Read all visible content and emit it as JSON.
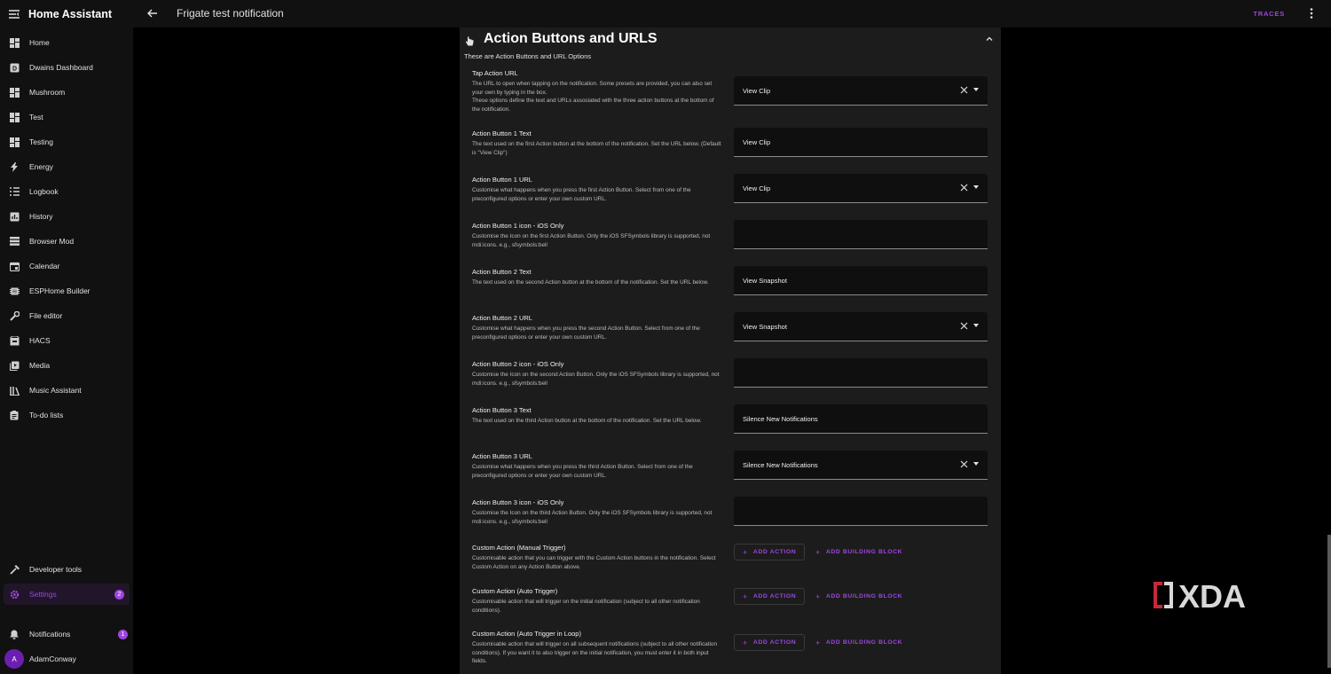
{
  "app": {
    "title": "Home Assistant"
  },
  "page": {
    "title": "Frigate test notification",
    "traces_label": "TRACES"
  },
  "sidebar": {
    "items": [
      {
        "label": "Home",
        "icon": "dashboard-icon"
      },
      {
        "label": "Dwains Dashboard",
        "icon": "dwains-icon"
      },
      {
        "label": "Mushroom",
        "icon": "dashboard-icon"
      },
      {
        "label": "Test",
        "icon": "dashboard-icon"
      },
      {
        "label": "Testing",
        "icon": "dashboard-icon"
      },
      {
        "label": "Energy",
        "icon": "lightning-icon"
      },
      {
        "label": "Logbook",
        "icon": "list-icon"
      },
      {
        "label": "History",
        "icon": "chart-icon"
      },
      {
        "label": "Browser Mod",
        "icon": "server-icon"
      },
      {
        "label": "Calendar",
        "icon": "calendar-icon"
      },
      {
        "label": "ESPHome Builder",
        "icon": "chip-icon"
      },
      {
        "label": "File editor",
        "icon": "wrench-icon"
      },
      {
        "label": "HACS",
        "icon": "hacs-icon"
      },
      {
        "label": "Media",
        "icon": "media-icon"
      },
      {
        "label": "Music Assistant",
        "icon": "library-icon"
      },
      {
        "label": "To-do lists",
        "icon": "clipboard-icon"
      }
    ],
    "developer_tools": "Developer tools",
    "settings": {
      "label": "Settings",
      "badge": "2"
    },
    "notifications": {
      "label": "Notifications",
      "badge": "1"
    },
    "user": {
      "name": "AdamConway",
      "initial": "A"
    }
  },
  "section": {
    "title": "Action Buttons and URLS",
    "description": "These are Action Buttons and URL Options"
  },
  "fields": [
    {
      "title": "Tap Action URL",
      "desc": "The URL to open when tapping on the notification. Some presets are provided, you can also set your own by typing in the box.",
      "desc2": "These options define the text and URLs associated with the three action buttons at the bottom of the notification.",
      "value": "View Clip",
      "clearable": true
    },
    {
      "title": "Action Button 1 Text",
      "desc": "The text used on the first Action button at the bottom of the notification. Set the URL below. (Default is \"View Clip\")",
      "value": "View Clip",
      "clearable": false
    },
    {
      "title": "Action Button 1 URL",
      "desc": "Customise what happens when you press the first Action Button. Select from one of the preconfigured options or enter your own custom URL.",
      "value": "View Clip",
      "clearable": true
    },
    {
      "title": "Action Button 1 icon - iOS Only",
      "desc": "Customise the Icon on the first Action Button. Only the iOS SFSymbols library is supported, not mdi:icons. e.g., sfsymbols:bell",
      "value": "",
      "clearable": false
    },
    {
      "title": "Action Button 2 Text",
      "desc": "The text used on the second Action button at the bottom of the notification. Set the URL below.",
      "value": "View Snapshot",
      "clearable": false
    },
    {
      "title": "Action Button 2 URL",
      "desc": "Customise what happens when you press the second Action Button. Select from one of the preconfigured options or enter your own custom URL.",
      "value": "View Snapshot",
      "clearable": true
    },
    {
      "title": "Action Button 2 icon - iOS Only",
      "desc": "Customise the Icon on the second Action Button. Only the iOS SFSymbols library is supported, not mdi:icons. e.g., sfsymbols:bell",
      "value": "",
      "clearable": false
    },
    {
      "title": "Action Button 3 Text",
      "desc": "The text used on the third Action button at the bottom of the notification. Set the URL below.",
      "value": "Silence New Notifications",
      "clearable": false
    },
    {
      "title": "Action Button 3 URL",
      "desc": "Customise what happens when you press the third Action Button. Select from one of the preconfigured options or enter your own custom URL.",
      "value": "Silence New Notifications",
      "clearable": true
    },
    {
      "title": "Action Button 3 icon - iOS Only",
      "desc": "Customise the Icon on the third Action Button. Only the iOS SFSymbols library is supported, not mdi:icons. e.g., sfsymbols:bell",
      "value": "",
      "clearable": false
    }
  ],
  "custom_actions": [
    {
      "title": "Custom Action (Manual Trigger)",
      "desc": "Customisable action that you can trigger with the Custom Action buttons in the notification. Select Custom Action on any Action Button above."
    },
    {
      "title": "Custom Action (Auto Trigger)",
      "desc": "Customisable action that will trigger on the initial notification (subject to all other notification conditions)."
    },
    {
      "title": "Custom Action (Auto Trigger in Loop)",
      "desc": "Customisable action that will trigger on all subsequent notifications (subject to all other notification conditions). If you want it to also trigger on the initial notification, you must enter it in both input fields."
    }
  ],
  "buttons": {
    "add_action": "ADD ACTION",
    "add_building_block": "ADD BUILDING BLOCK"
  },
  "watermark": {
    "text": "XDA"
  },
  "colors": {
    "accent": "#9c46e0",
    "background": "#000000",
    "sidebar": "#111111",
    "card": "#1c1c1c"
  }
}
